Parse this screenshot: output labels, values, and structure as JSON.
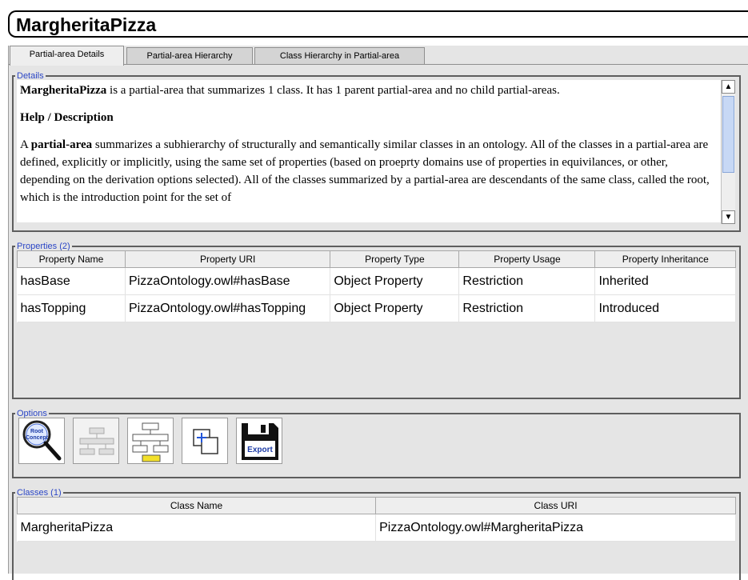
{
  "title": "MargheritaPizza",
  "tabs": [
    {
      "label": "Partial-area Details",
      "active": true
    },
    {
      "label": "Partial-area Hierarchy",
      "active": false
    },
    {
      "label": "Class Hierarchy in Partial-area",
      "active": false
    }
  ],
  "details": {
    "legend": "Details",
    "summary_name": "MargheritaPizza",
    "summary_rest": " is a partial-area that summarizes 1 class. It has 1 parent partial-area and no child partial-areas.",
    "help_heading": "Help / Description",
    "desc_prefix": "A ",
    "desc_term": "partial-area",
    "desc_rest": " summarizes a subhierarchy of structurally and semantically similar classes in an ontology. All of the classes in a partial-area are defined, explicitly or implicitly, using the same set of properties (based on proeprty domains use of properties in equivilances, or other, depending on the derivation options selected). All of the classes summarized by a partial-area are descendants of the same class, called the root, which is the introduction point for the set of"
  },
  "properties": {
    "legend": "Properties (2)",
    "columns": [
      "Property Name",
      "Property URI",
      "Property Type",
      "Property Usage",
      "Property Inheritance"
    ],
    "rows": [
      [
        "hasBase",
        "PizzaOntology.owl#hasBase",
        "Object Property",
        "Restriction",
        "Inherited"
      ],
      [
        "hasTopping",
        "PizzaOntology.owl#hasTopping",
        "Object Property",
        "Restriction",
        "Introduced"
      ]
    ]
  },
  "options": {
    "legend": "Options",
    "buttons": [
      {
        "icon": "root-concept-magnifier-icon",
        "label": "Root Concept",
        "enabled": true
      },
      {
        "icon": "hierarchy-icon",
        "enabled": false
      },
      {
        "icon": "partial-area-hierarchy-icon",
        "enabled": true
      },
      {
        "icon": "expand-icon",
        "enabled": true
      },
      {
        "icon": "export-icon",
        "label": "Export",
        "enabled": true
      }
    ]
  },
  "classes": {
    "legend": "Classes (1)",
    "columns": [
      "Class Name",
      "Class URI"
    ],
    "rows": [
      [
        "MargheritaPizza",
        "PizzaOntology.owl#MargheritaPizza"
      ]
    ]
  }
}
